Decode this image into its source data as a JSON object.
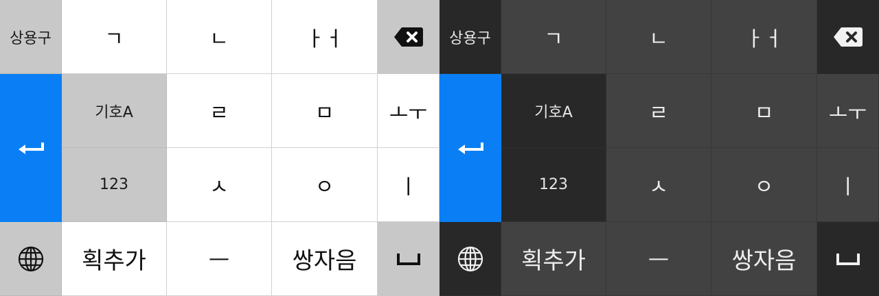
{
  "keyboards": [
    {
      "theme": "light",
      "row1": {
        "fn": "상용구",
        "keys": [
          "ㄱ",
          "ㄴ",
          "ㅏㅓ"
        ]
      },
      "row2": {
        "fn": "기호A",
        "keys": [
          "ㄹ",
          "ㅁ",
          "ㅗㅜ"
        ]
      },
      "row3": {
        "fn": "123",
        "keys": [
          "ㅅ",
          "ㅇ",
          "ㅣ"
        ]
      },
      "row4": {
        "keys": [
          "획추가",
          "—",
          "쌍자음"
        ]
      }
    },
    {
      "theme": "dark",
      "row1": {
        "fn": "상용구",
        "keys": [
          "ㄱ",
          "ㄴ",
          "ㅏㅓ"
        ]
      },
      "row2": {
        "fn": "기호A",
        "keys": [
          "ㄹ",
          "ㅁ",
          "ㅗㅜ"
        ]
      },
      "row3": {
        "fn": "123",
        "keys": [
          "ㅅ",
          "ㅇ",
          "ㅣ"
        ]
      },
      "row4": {
        "keys": [
          "획추가",
          "—",
          "쌍자음"
        ]
      }
    }
  ],
  "icons": {
    "backspace": "backspace-icon",
    "enter": "enter-icon",
    "globe": "globe-icon",
    "space": "space-icon"
  },
  "colors": {
    "enter": "#0a7ff5",
    "light_fn": "#c8c8c8",
    "light_key": "#ffffff",
    "dark_fn": "#282828",
    "dark_key": "#424242"
  }
}
